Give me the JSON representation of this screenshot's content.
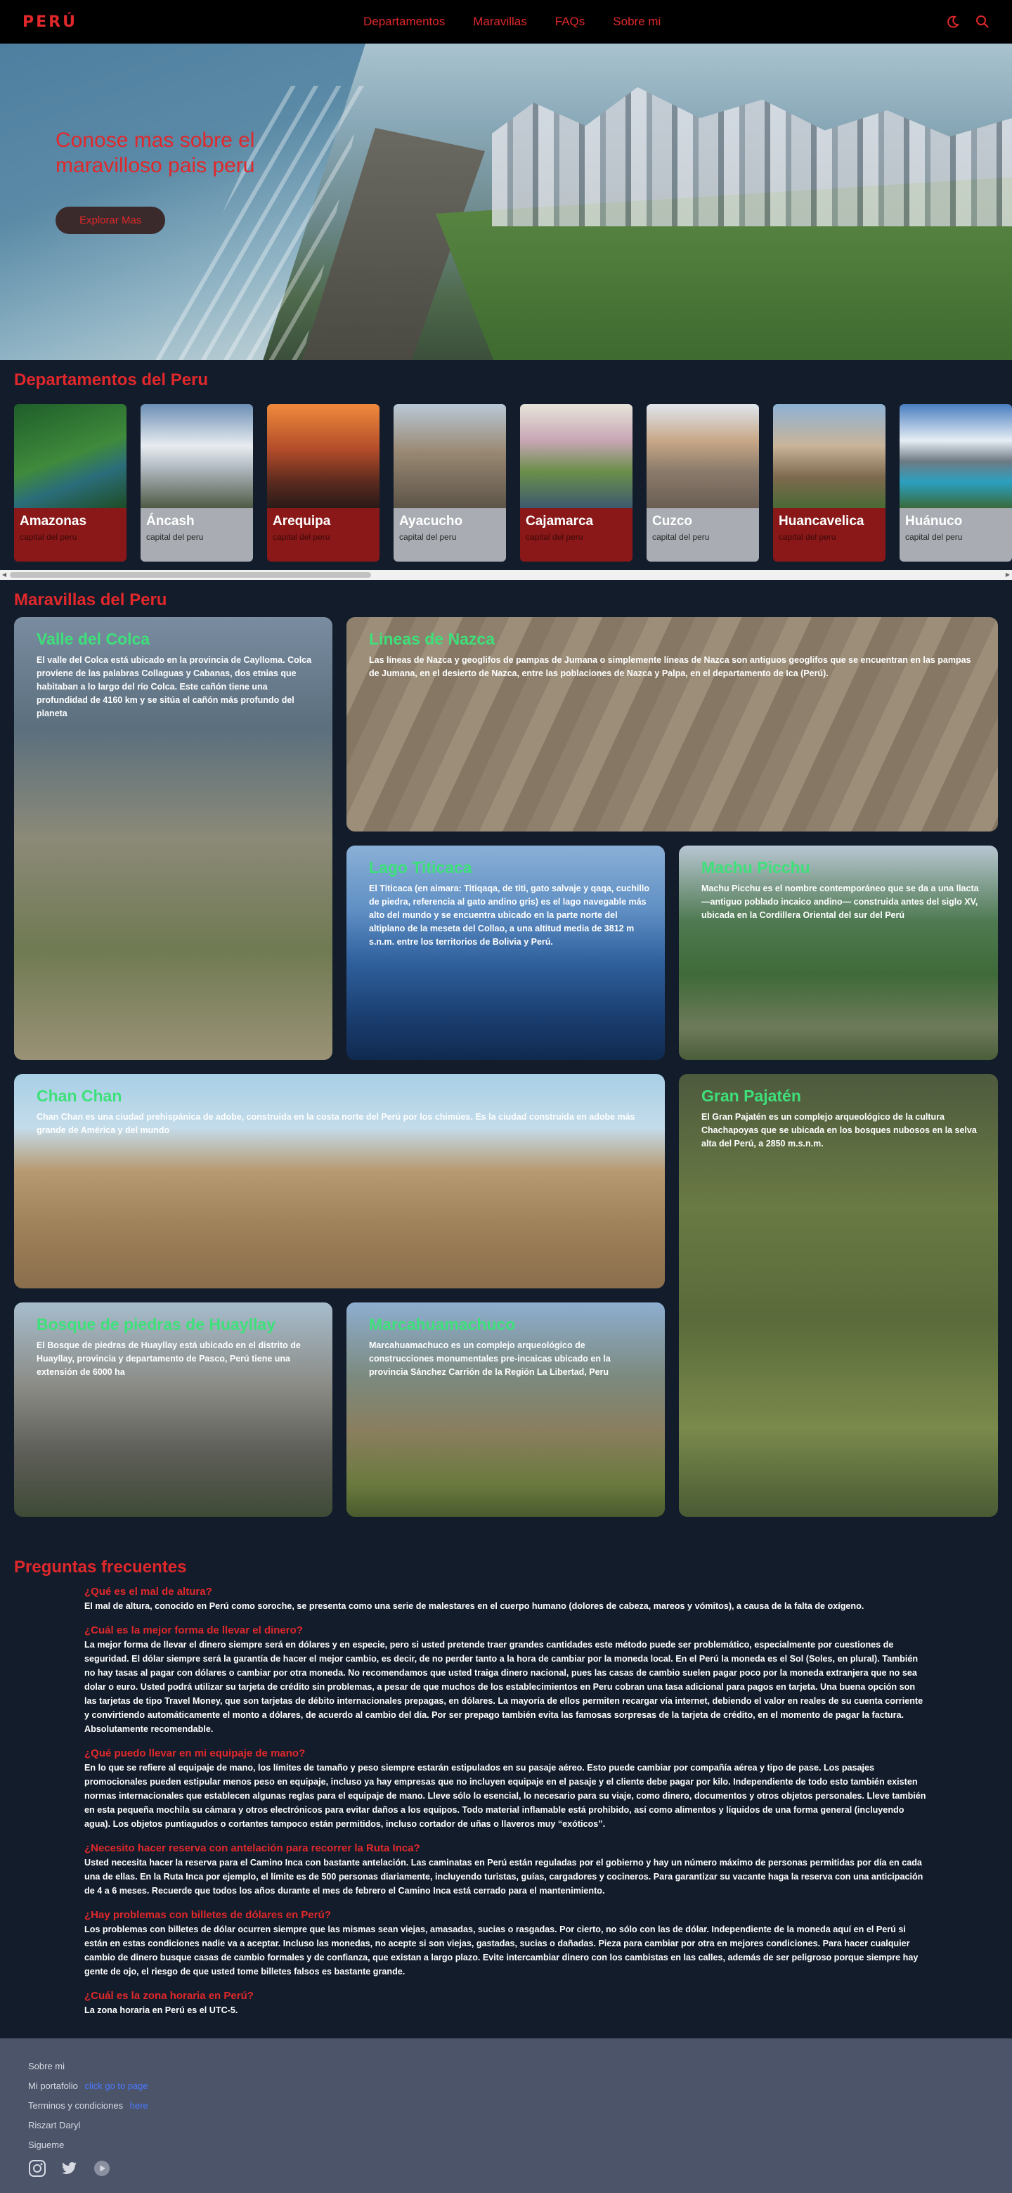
{
  "nav": {
    "logo": "PERÚ",
    "links": [
      "Departamentos",
      "Maravillas",
      "FAQs",
      "Sobre mi"
    ],
    "icons": [
      "moon-icon",
      "search-icon"
    ],
    "accent": "#e0282b"
  },
  "hero": {
    "title": "Conose mas sobre el maravilloso pais peru",
    "button": "Explorar Mas"
  },
  "departments": {
    "title": "Departamentos del Peru",
    "items": [
      {
        "name": "Amazonas",
        "sub": "capital del peru"
      },
      {
        "name": "Áncash",
        "sub": "capital del peru"
      },
      {
        "name": "Arequipa",
        "sub": "capital del peru"
      },
      {
        "name": "Ayacucho",
        "sub": "capital del peru"
      },
      {
        "name": "Cajamarca",
        "sub": "capital del peru"
      },
      {
        "name": "Cuzco",
        "sub": "capital del peru"
      },
      {
        "name": "Huancavelica",
        "sub": "capital del peru"
      },
      {
        "name": "Huánuco",
        "sub": "capital del peru"
      }
    ]
  },
  "wonders": {
    "title": "Maravillas del Peru",
    "items": [
      {
        "title": "Valle del Colca",
        "desc": "El valle del Colca está ubicado en la provincia de Caylloma. Colca proviene de las palabras Collaguas y Cabanas, dos etnias que habitaban a lo largo del río Colca. Este cañón tiene una profundidad de 4160 km y se sitúa el cañón más profundo del planeta"
      },
      {
        "title": "Lineas de Nazca",
        "desc": "Las líneas de Nazca y geoglifos de pampas de Jumana o simplemente líneas de Nazca son antiguos geoglifos que se encuentran en las pampas de Jumana, en el desierto de Nazca, entre las poblaciones de Nazca y Palpa, en el departamento de Ica (Perú)."
      },
      {
        "title": "Lago Titicaca",
        "desc": "El Titicaca (en aimara: Titiqaqa, de titi, gato salvaje y qaqa, cuchillo de piedra, referencia al gato andino gris) es el lago navegable más alto del mundo y se encuentra ubicado en la parte norte del altiplano de la meseta del Collao, a una altitud media de 3812 m s.n.m. entre los territorios de Bolivia y Perú."
      },
      {
        "title": "Machu Picchu",
        "desc": "Machu Picchu es el nombre contemporáneo que se da a una llacta —antiguo poblado incaico andino— construida antes del siglo XV, ubicada en la Cordillera Oriental del sur del Perú"
      },
      {
        "title": "Chan Chan",
        "desc": "Chan Chan es una ciudad prehispánica de adobe, construida en la costa norte del Perú por los chimúes. Es la ciudad construida en adobe más grande de América y del mundo"
      },
      {
        "title": "Gran Pajatén",
        "desc": "El Gran Pajatén es un complejo arqueológico de la cultura Chachapoyas que se ubicada en los bosques nubosos en la selva alta del Perú, a 2850 m.s.n.m."
      },
      {
        "title": "Bosque de piedras de Huayllay",
        "desc": "El Bosque de piedras de Huayllay está ubicado en el distrito de Huayllay, provincia y departamento de Pasco, Perú tiene una extensión de 6000 ha"
      },
      {
        "title": "Marcahuamachuco",
        "desc": "Marcahuamachuco es un complejo arqueológico de construcciones monumentales pre-incaicas ubicado en la provincia Sánchez Carrión de la Región La Libertad, Peru"
      }
    ]
  },
  "faq": {
    "title": "Preguntas frecuentes",
    "items": [
      {
        "q": "¿Qué es el mal de altura?",
        "a": "El mal de altura, conocido en Perú como soroche, se presenta como una serie de malestares en el cuerpo humano (dolores de cabeza, mareos y vómitos), a causa de la falta de oxígeno."
      },
      {
        "q": "¿Cuál es la mejor forma de llevar el dinero?",
        "a": "La mejor forma de llevar el dinero siempre será en dólares y en especie, pero si usted pretende traer grandes cantidades este método puede ser problemático, especialmente por cuestiones de seguridad. El dólar siempre será la garantía de hacer el mejor cambio, es decir, de no perder tanto a la hora de cambiar por la moneda local. En el Perú la moneda es el Sol (Soles, en plural). También no hay tasas al pagar con dólares o cambiar por otra moneda. No recomendamos que usted traiga dinero nacional, pues las casas de cambio suelen pagar poco por la moneda extranjera que no sea dolar o euro. Usted podrá utilizar su tarjeta de crédito sin problemas, a pesar de que muchos de los establecimientos en Peru cobran una tasa adicional para pagos en tarjeta. Una buena opción son las tarjetas de tipo Travel Money, que son tarjetas de débito internacionales prepagas, en dólares. La mayoría de ellos permiten recargar vía internet, debiendo el valor en reales de su cuenta corriente y convirtiendo automáticamente el monto a dólares, de acuerdo al cambio del día. Por ser prepago también evita las famosas sorpresas de la tarjeta de crédito, en el momento de pagar la factura. Absolutamente recomendable."
      },
      {
        "q": "¿Qué puedo llevar en mi equipaje de mano?",
        "a": "En lo que se refiere al equipaje de mano, los límites de tamaño y peso siempre estarán estipulados en su pasaje aéreo. Esto puede cambiar por compañía aérea y tipo de pase. Los pasajes promocionales pueden estipular menos peso en equipaje, incluso ya hay empresas que no incluyen equipaje en el pasaje y el cliente debe pagar por kilo. Independiente de todo esto también existen normas internacionales que establecen algunas reglas para el equipaje de mano. Lleve sólo lo esencial, lo necesario para su viaje, como dinero, documentos y otros objetos personales. Lleve también en esta pequeña mochila su cámara y otros electrónicos para evitar daños a los equipos. Todo material inflamable está prohibido, así como alimentos y líquidos de una forma general (incluyendo agua). Los objetos puntiagudos o cortantes tampoco están permitidos, incluso cortador de uñas o llaveros muy “exóticos”."
      },
      {
        "q": "¿Necesito hacer reserva con antelación para recorrer la Ruta Inca?",
        "a": "Usted necesita hacer la reserva para el Camino Inca con bastante antelación. Las caminatas en Perú están reguladas por el gobierno y hay un número máximo de personas permitidas por día en cada una de ellas. En la Ruta Inca por ejemplo, el límite es de 500 personas diariamente, incluyendo turistas, guías, cargadores y cocineros. Para garantizar su vacante haga la reserva con una anticipación de 4 a 6 meses. Recuerde que todos los años durante el mes de febrero el Camino Inca está cerrado para el mantenimiento."
      },
      {
        "q": "¿Hay problemas con billetes de dólares en Perú?",
        "a": "Los problemas con billetes de dólar ocurren siempre que las mismas sean viejas, amasadas, sucias o rasgadas. Por cierto, no sólo con las de dólar. Independiente de la moneda aquí en el Perú si están en estas condiciones nadie va a aceptar. Incluso las monedas, no acepte si son viejas, gastadas, sucias o dañadas. Pieza para cambiar por otra en mejores condiciones. Para hacer cualquier cambio de dinero busque casas de cambio formales y de confianza, que existan a largo plazo. Evite intercambiar dinero con los cambistas en las calles, además de ser peligroso porque siempre hay gente de ojo, el riesgo de que usted tome billetes falsos es bastante grande."
      },
      {
        "q": "¿Cuál es la zona horaria en Perú?",
        "a": "La zona horaria en Perú es el UTC-5."
      }
    ]
  },
  "footer": {
    "about": "Sobre mi",
    "portfolio": "Mi portafolio",
    "portfolio_link": "click go to page",
    "terms": "Terminos y condiciones",
    "terms_link": "here",
    "author": "Riszart Daryl",
    "follow": "Sigueme",
    "social": [
      "instagram-icon",
      "twitter-icon",
      "youtube-icon"
    ]
  }
}
